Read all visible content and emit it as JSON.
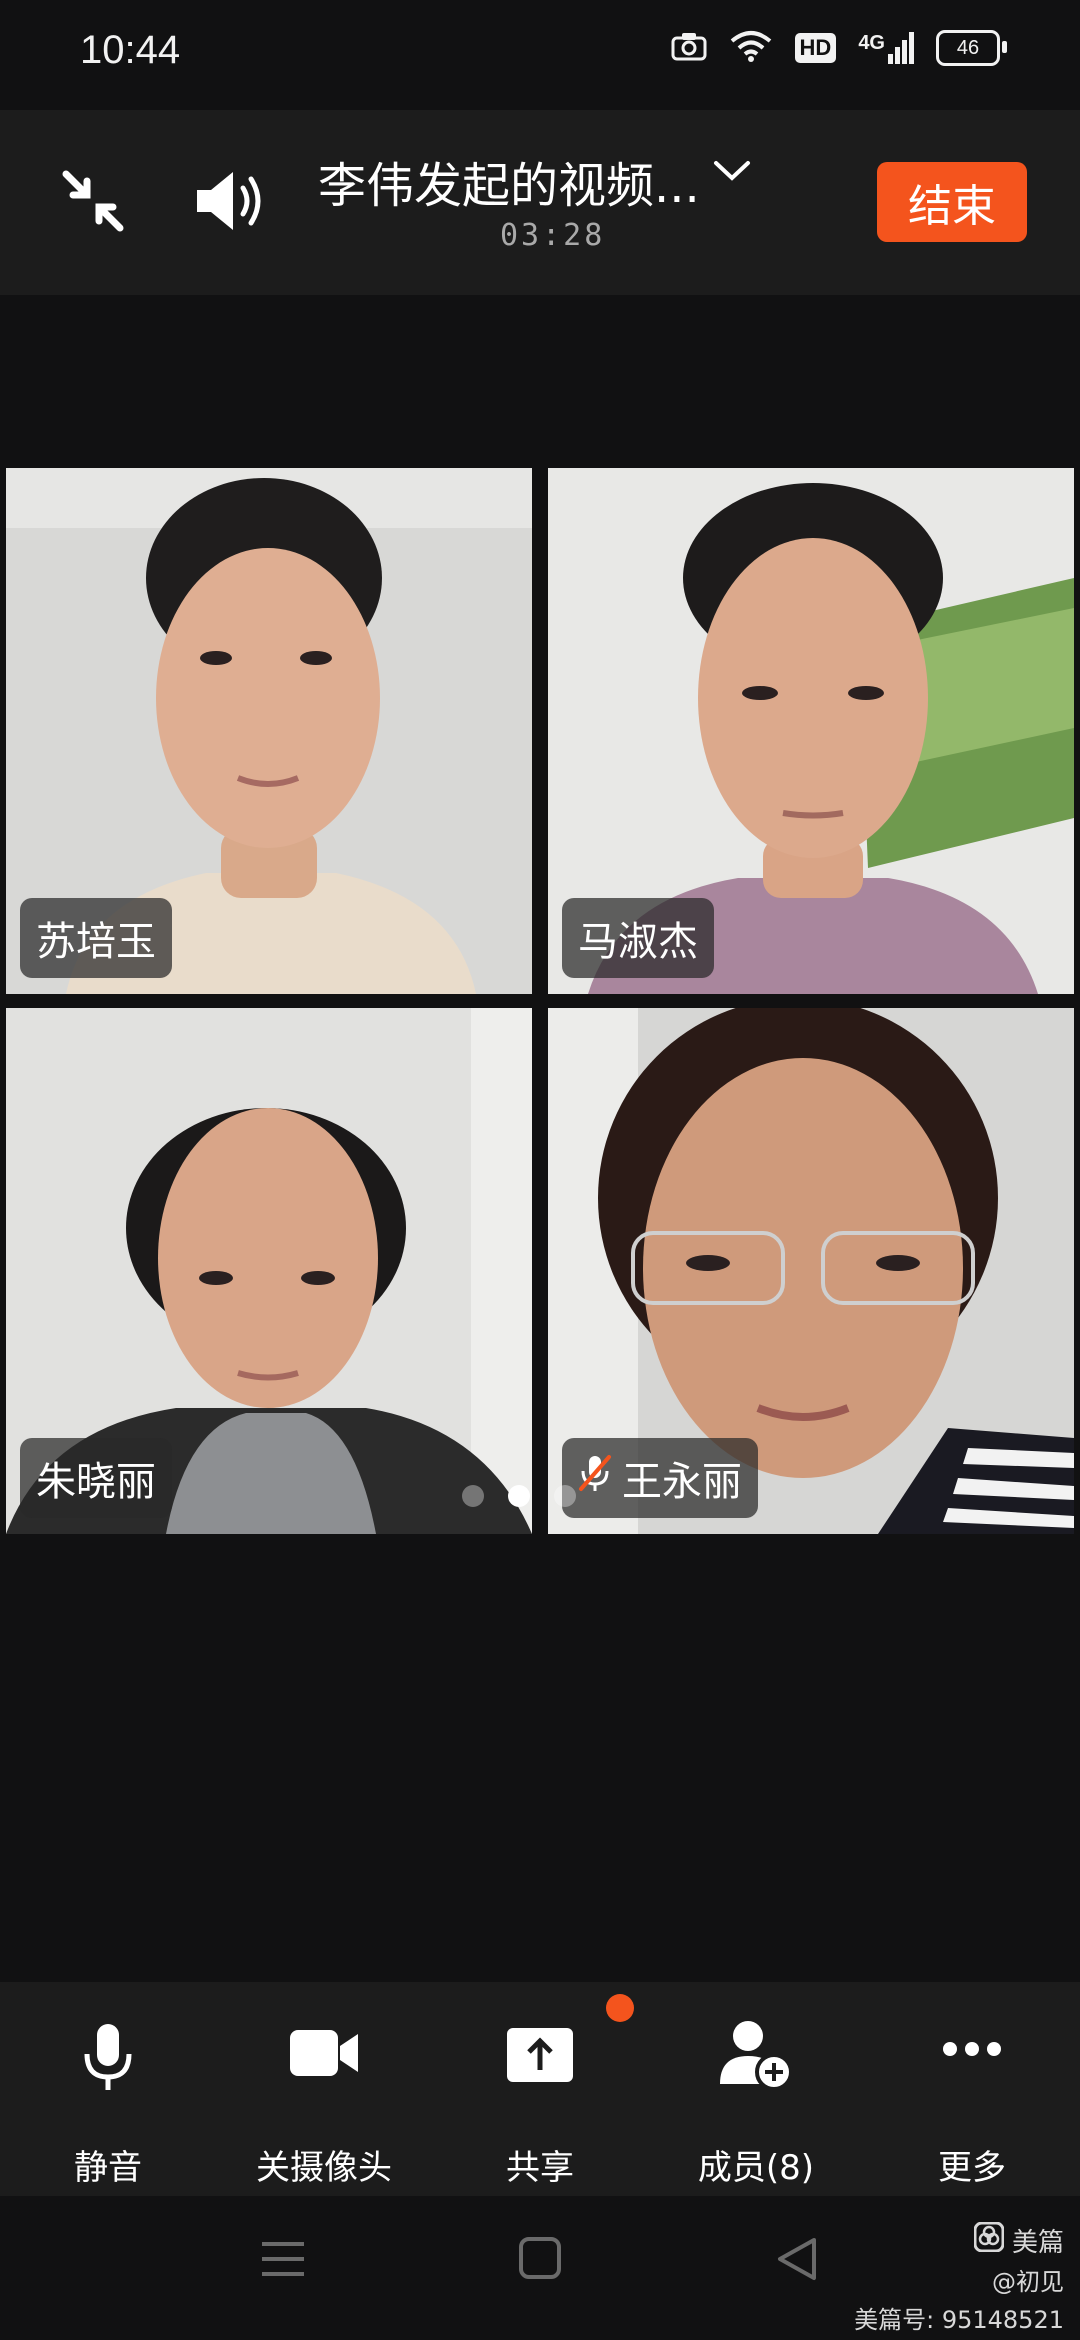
{
  "status_bar": {
    "time": "10:44",
    "hd": "HD",
    "network": "4G",
    "battery": "46"
  },
  "header": {
    "title": "李伟发起的视频...",
    "timer": "03:28",
    "end_label": "结束"
  },
  "participants": [
    {
      "name": "苏培玉",
      "muted": false
    },
    {
      "name": "马淑杰",
      "muted": false
    },
    {
      "name": "朱晓丽",
      "muted": false
    },
    {
      "name": "王永丽",
      "muted": true
    }
  ],
  "pager": {
    "pages": 3,
    "active_index": 1
  },
  "toolbar": {
    "mute_label": "静音",
    "camera_label": "关摄像头",
    "share_label": "共享",
    "members_label": "成员(8)",
    "more_label": "更多"
  },
  "watermark": {
    "brand": "美篇",
    "handle": "@初见",
    "id_line": "美篇号: 95148521"
  },
  "colors": {
    "accent": "#f4541d",
    "background": "#111112",
    "bar": "#1c1c1c"
  },
  "icons": [
    "camera-icon",
    "wifi-icon",
    "collapse-icon",
    "speaker-icon",
    "chevron-down-icon",
    "microphone-icon",
    "video-camera-icon",
    "share-upload-icon",
    "add-member-icon",
    "more-dots-icon",
    "menu-nav-icon",
    "home-nav-icon",
    "back-nav-icon",
    "mic-off-icon"
  ]
}
